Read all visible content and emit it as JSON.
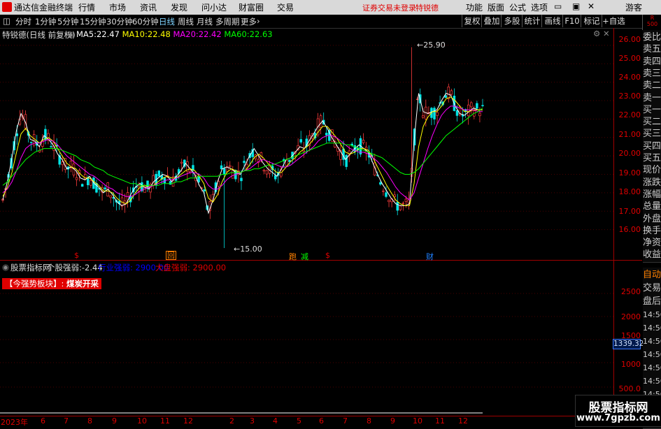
{
  "titlebar": {
    "app_name": "通达信金融终端",
    "menus": [
      "行情",
      "市场",
      "资讯",
      "发现",
      "问小达",
      "财富圈",
      "交易"
    ],
    "notice": "证券交易未登录",
    "stock": "特锐德",
    "right_menus": [
      "功能",
      "版面",
      "公式",
      "选项"
    ],
    "user": "游客",
    "badge": "R\n500"
  },
  "toolbar": {
    "periods": [
      "分时",
      "1分钟",
      "5分钟",
      "15分钟",
      "30分钟",
      "60分钟",
      "日线",
      "周线",
      "月线",
      "多周期",
      "更多"
    ],
    "selected": "日线",
    "right_buttons": [
      "复权",
      "叠加",
      "多股",
      "统计",
      "画线",
      "F10",
      "标记",
      "+自选"
    ]
  },
  "main_chart": {
    "stock_title": "特锐德(日线 前复权)",
    "ma": [
      {
        "label": "MA5:",
        "value": "22.47",
        "color": "#ffffff"
      },
      {
        "label": "MA10:",
        "value": "22.48",
        "color": "#ffff00"
      },
      {
        "label": "MA20:",
        "value": "22.42",
        "color": "#ff00ff"
      },
      {
        "label": "MA60:",
        "value": "22.63",
        "color": "#00ff00"
      }
    ],
    "high_label": "25.90",
    "low_label": "15.00",
    "y_ticks": [
      "26.00",
      "25.00",
      "24.00",
      "23.00",
      "22.00",
      "21.00",
      "20.00",
      "19.00",
      "18.00",
      "17.00",
      "16.00"
    ],
    "markers": [
      {
        "text": "$",
        "color": "#e00000"
      },
      {
        "text": "回",
        "color": "#ff8000"
      },
      {
        "text": "跑",
        "color": "#ff8000"
      },
      {
        "text": "减",
        "color": "#00ff00"
      },
      {
        "text": "$",
        "color": "#e00000"
      },
      {
        "text": "财",
        "color": "#2080ff"
      }
    ]
  },
  "sub_chart": {
    "title": "股票指标网",
    "item1_label": "个股强弱:",
    "item1_value": "-2.44",
    "item2": "行业强弱: 2900.00",
    "item3": "大盘强弱: 2900.00",
    "strong_block": "【今强势板块】:",
    "strong_block_value": "煤炭开采",
    "y_ticks": [
      "2500",
      "2000",
      "1500",
      "1000",
      "500.0"
    ],
    "current_value": "1339.32"
  },
  "x_axis": {
    "labels": [
      "2023年",
      "6",
      "7",
      "8",
      "9",
      "10",
      "11",
      "12",
      "2",
      "3",
      "4",
      "5",
      "6",
      "7",
      "8",
      "9",
      "10",
      "11",
      "12"
    ]
  },
  "side_panel": {
    "items": [
      "委比",
      "卖五",
      "卖四",
      "卖三",
      "卖二",
      "卖一",
      "买一",
      "买二",
      "买三",
      "买四",
      "买五",
      "现价",
      "涨跌",
      "涨幅",
      "总量",
      "外盘",
      "换手",
      "净资",
      "收益"
    ],
    "lower_items": [
      "自动",
      "交易",
      "盘后",
      "14:56",
      "14:56",
      "14:56",
      "14:56",
      "14:56",
      "14:56",
      "14:56",
      "14:56",
      "14:56"
    ]
  },
  "watermark": {
    "line1": "股票指标网",
    "line2": "www.7gpzb.com"
  },
  "chart_data": {
    "type": "line",
    "title": "特锐德(日线 前复权)",
    "ylim": [
      15,
      26.3
    ],
    "x_count": 180,
    "series": [
      {
        "name": "MA5",
        "color": "#ffffff",
        "values": [
          17.6,
          18.6,
          19.9,
          21.4,
          22.3,
          21.8,
          20.9,
          20.8,
          20.5,
          21.1,
          20.9,
          20.6,
          20.1,
          19.8,
          19.3,
          19.4,
          19.2,
          18.8,
          18.7,
          18.9,
          18.5,
          18.3,
          18.0,
          18.2,
          17.9,
          17.5,
          17.3,
          17.4,
          17.9,
          18.3,
          18.5,
          18.3,
          18.2,
          18.6,
          18.8,
          19.0,
          18.9,
          18.6,
          18.9,
          19.2,
          19.6,
          19.3,
          19.0,
          18.4,
          18.0,
          16.9,
          17.6,
          18.6,
          19.3,
          19.4,
          19.3,
          19.1,
          19.0,
          19.5,
          20.0,
          20.4,
          20.0,
          19.6,
          19.3,
          19.1,
          18.9,
          19.3,
          19.8,
          19.9,
          20.2,
          20.5,
          20.4,
          20.8,
          21.2,
          21.6,
          21.9,
          21.5,
          21.0,
          20.6,
          20.2,
          19.8,
          20.1,
          20.4,
          20.6,
          20.4,
          20.2,
          19.6,
          19.0,
          18.5,
          18.1,
          17.7,
          17.4,
          17.3,
          17.3,
          17.4,
          20.8,
          23.4,
          22.4,
          22.3,
          22.4,
          22.5,
          23.0,
          23.4,
          23.3,
          22.7,
          22.3,
          22.2,
          22.4,
          22.6,
          22.5,
          22.5
        ]
      },
      {
        "name": "MA10",
        "color": "#ffff00",
        "values": [
          17.8,
          18.3,
          19.1,
          20.2,
          21.2,
          21.5,
          21.1,
          20.9,
          20.7,
          20.9,
          21.0,
          20.8,
          20.4,
          20.0,
          19.6,
          19.4,
          19.3,
          19.0,
          18.8,
          18.8,
          18.6,
          18.4,
          18.1,
          18.1,
          18.0,
          17.7,
          17.5,
          17.4,
          17.6,
          18.0,
          18.3,
          18.4,
          18.3,
          18.4,
          18.6,
          18.8,
          18.9,
          18.8,
          18.8,
          19.0,
          19.2,
          19.3,
          19.2,
          18.9,
          18.5,
          17.7,
          17.5,
          17.9,
          18.6,
          19.1,
          19.3,
          19.2,
          19.1,
          19.2,
          19.5,
          19.9,
          20.1,
          19.9,
          19.6,
          19.3,
          19.1,
          19.1,
          19.4,
          19.7,
          19.9,
          20.2,
          20.4,
          20.6,
          20.9,
          21.3,
          21.6,
          21.6,
          21.3,
          21.0,
          20.6,
          20.2,
          20.1,
          20.2,
          20.4,
          20.4,
          20.3,
          19.9,
          19.4,
          18.9,
          18.4,
          18.0,
          17.6,
          17.4,
          17.3,
          17.3,
          18.5,
          20.5,
          21.6,
          22.1,
          22.4,
          22.4,
          22.7,
          23.1,
          23.2,
          23.0,
          22.7,
          22.4,
          22.4,
          22.5,
          22.5,
          22.5
        ]
      },
      {
        "name": "MA20",
        "color": "#ff00ff",
        "values": [
          18.0,
          18.2,
          18.6,
          19.2,
          19.9,
          20.4,
          20.6,
          20.7,
          20.7,
          20.8,
          20.9,
          20.8,
          20.6,
          20.3,
          20.0,
          19.8,
          19.6,
          19.4,
          19.2,
          19.0,
          18.9,
          18.7,
          18.5,
          18.3,
          18.2,
          18.0,
          17.9,
          17.8,
          17.8,
          17.9,
          18.1,
          18.2,
          18.3,
          18.4,
          18.5,
          18.6,
          18.7,
          18.7,
          18.8,
          18.9,
          19.0,
          19.1,
          19.1,
          19.0,
          18.8,
          18.4,
          18.2,
          18.2,
          18.4,
          18.7,
          18.9,
          19.0,
          19.1,
          19.2,
          19.3,
          19.5,
          19.7,
          19.8,
          19.7,
          19.6,
          19.5,
          19.4,
          19.4,
          19.5,
          19.7,
          19.9,
          20.1,
          20.3,
          20.5,
          20.8,
          21.0,
          21.1,
          21.1,
          21.0,
          20.8,
          20.6,
          20.4,
          20.3,
          20.2,
          20.2,
          20.1,
          19.9,
          19.7,
          19.4,
          19.1,
          18.7,
          18.3,
          18.0,
          17.8,
          17.6,
          18.0,
          18.8,
          19.6,
          20.4,
          21.1,
          21.7,
          22.2,
          22.5,
          22.7,
          22.7,
          22.6,
          22.5,
          22.5,
          22.5,
          22.4,
          22.4
        ]
      },
      {
        "name": "MA60",
        "color": "#00ff00",
        "values": [
          18.4,
          18.6,
          18.9,
          19.2,
          19.5,
          19.8,
          20.0,
          20.2,
          20.3,
          20.4,
          20.4,
          20.4,
          20.4,
          20.3,
          20.2,
          20.1,
          20.0,
          19.8,
          19.7,
          19.6,
          19.4,
          19.3,
          19.2,
          19.0,
          18.9,
          18.8,
          18.7,
          18.6,
          18.5,
          18.5,
          18.4,
          18.4,
          18.4,
          18.4,
          18.4,
          18.5,
          18.5,
          18.5,
          18.6,
          18.6,
          18.7,
          18.8,
          18.8,
          18.9,
          18.9,
          18.9,
          18.9,
          18.9,
          19.0,
          19.0,
          19.1,
          19.1,
          19.1,
          19.2,
          19.2,
          19.3,
          19.3,
          19.4,
          19.5,
          19.5,
          19.6,
          19.7,
          19.8,
          19.9,
          20.0,
          20.1,
          20.2,
          20.3,
          20.4,
          20.5,
          20.6,
          20.7,
          20.7,
          20.7,
          20.7,
          20.6,
          20.6,
          20.5,
          20.4,
          20.3,
          20.2,
          20.1,
          20.0,
          19.9,
          19.7,
          19.5,
          19.3,
          19.1,
          19.0,
          19.0,
          19.1,
          19.3,
          19.6,
          19.9,
          20.2,
          20.5,
          20.8,
          21.1,
          21.3,
          21.5,
          21.7,
          21.9,
          22.1,
          22.3,
          22.4,
          22.6
        ]
      }
    ]
  }
}
